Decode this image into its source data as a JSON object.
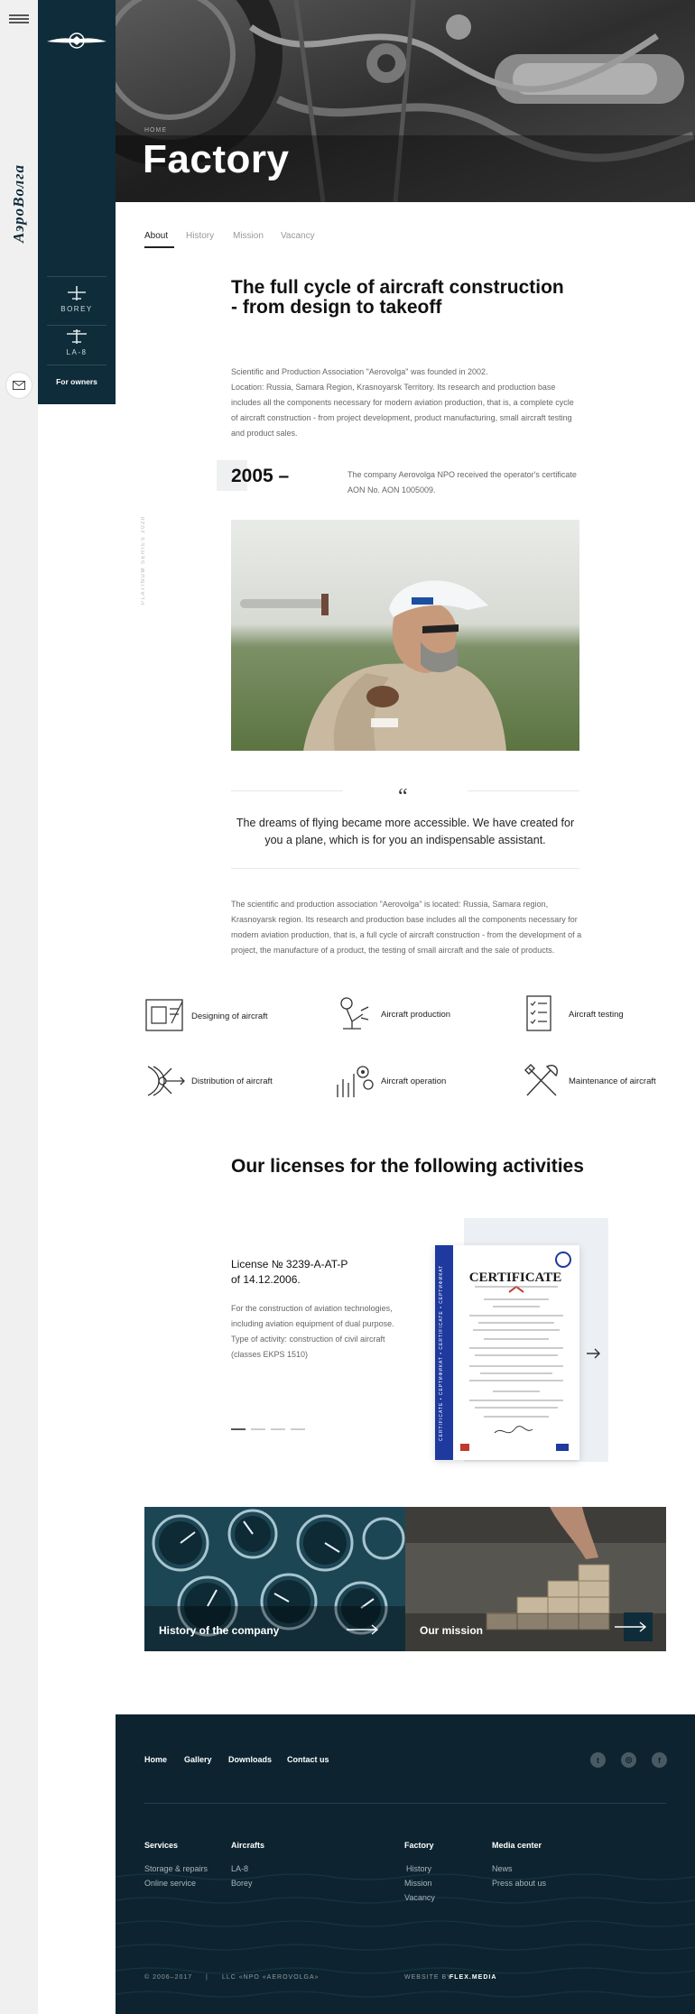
{
  "sidebar": {
    "brand": "АэроВолга",
    "planes": [
      "BOREY",
      "LA-8"
    ],
    "owners_label": "For owners"
  },
  "hero": {
    "breadcrumb": "HOME",
    "title": "Factory"
  },
  "tabs": [
    "About",
    "History",
    "Mission",
    "Vacancy"
  ],
  "intro": {
    "heading": "The full cycle of aircraft construction - from design to takeoff",
    "paragraph1": "Scientific and Production Association \"Aerovolga\" was founded in 2002.",
    "paragraph2": "Location: Russia, Samara Region, Krasnoyarsk Territory. Its research and production base includes all the components necessary for modern aviation production, that is, a complete cycle of aircraft construction - from project development, product manufacturing, small aircraft testing and product sales."
  },
  "milestone": {
    "year": "2005 –",
    "text": "The company Aerovolga NPO received the operator's certificate AON No. AON 1005009."
  },
  "side_caption": "PLATINUM SERIES 2020",
  "quote": {
    "mark": "“",
    "text": "The dreams of flying became more accessible. We have created for you a plane, which is for you an indispensable assistant."
  },
  "about_text": "The scientific and production association \"Aerovolga\" is located: Russia, Samara region, Krasnoyarsk region. Its research and production base includes all the components necessary for modern aviation production, that is, a full cycle of aircraft construction - from the development of a project, the manufacture of a product, the testing of small aircraft and the sale of products.",
  "features": [
    {
      "label": "Designing of aircraft",
      "icon": "blueprint-icon"
    },
    {
      "label": "Aircraft production",
      "icon": "robot-arm-icon"
    },
    {
      "label": "Aircraft testing",
      "icon": "checklist-icon"
    },
    {
      "label": "Distribution of aircraft",
      "icon": "distribution-icon"
    },
    {
      "label": "Aircraft operation",
      "icon": "gears-chart-icon"
    },
    {
      "label": "Maintenance of aircraft",
      "icon": "tools-icon"
    }
  ],
  "licenses": {
    "heading": "Our licenses for the following activities",
    "title_line1": "License № 3239-A-AT-P",
    "title_line2": "of 14.12.2006.",
    "desc": "For the construction of aviation technologies, including aviation equipment of dual purpose. Type of activity: construction of civil aircraft (classes EKPS 1510)",
    "cert_title": "CERTIFICATE",
    "cert_band": "CERTIFICATE • СЕРТИФИКАТ • CERTIFICATE • СЕРТИФИКАТ"
  },
  "cards": [
    {
      "label": "History of the company"
    },
    {
      "label": "Our mission"
    }
  ],
  "footer": {
    "nav": [
      "Home",
      "Gallery",
      "Downloads",
      "Contact us"
    ],
    "columns": [
      {
        "title": "Services",
        "links": [
          "Storage & repairs",
          "Online service"
        ]
      },
      {
        "title": "Aircrafts",
        "links": [
          "LA-8",
          "Borey"
        ]
      },
      {
        "title": "Factory",
        "links": [
          "History",
          "Mission",
          "Vacancy"
        ]
      },
      {
        "title": "Media center",
        "links": [
          "News",
          "Press about us"
        ]
      }
    ],
    "copyright": "© 2006–2017",
    "divider": "|",
    "company": "LLC «NPO «AEROVOLGA»",
    "credit_prefix": "WEBSITE BY",
    "credit_name": "FLEX.MEDIA"
  },
  "colors": {
    "sidebar": "#0f2c3a",
    "footer": "#0d2430",
    "cert_band": "#1f3a9e"
  }
}
